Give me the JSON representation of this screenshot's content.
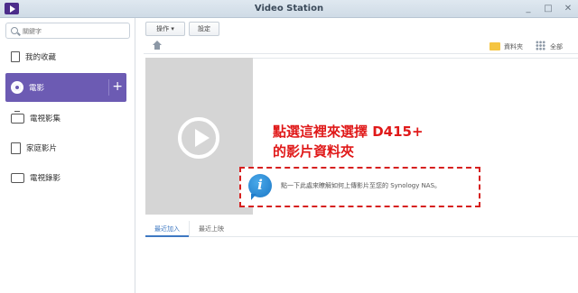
{
  "window": {
    "title": "Video Station",
    "controls": [
      "_",
      "□",
      "✕"
    ]
  },
  "sidebar": {
    "search_placeholder": "關鍵字",
    "items": [
      {
        "label": "我的收藏",
        "icon": "favorites-icon",
        "active": false
      },
      {
        "label": "電影",
        "icon": "movie-reel-icon",
        "active": true
      },
      {
        "label": "電視影集",
        "icon": "tv-show-icon",
        "active": false
      },
      {
        "label": "家庭影片",
        "icon": "home-video-icon",
        "active": false
      },
      {
        "label": "電視錄影",
        "icon": "tv-recording-icon",
        "active": false
      }
    ],
    "add_label": "+"
  },
  "toolbar": {
    "action_label": "操作 ▾",
    "settings_label": "設定"
  },
  "subbar": {
    "folder_label": "資料夾",
    "all_label": "全部"
  },
  "annotation": {
    "line1": "點選這裡來選擇 D415+",
    "line2": "的影片資料夾"
  },
  "info": {
    "text": "點一下此處來瞭解如何上傳影片至您的 Synology NAS。"
  },
  "tabs": {
    "recent": "最近加入",
    "uploaded": "最近上映"
  },
  "colors": {
    "accent": "#6c5bb3",
    "annotation": "#e01919",
    "info": "#1c78c6"
  }
}
